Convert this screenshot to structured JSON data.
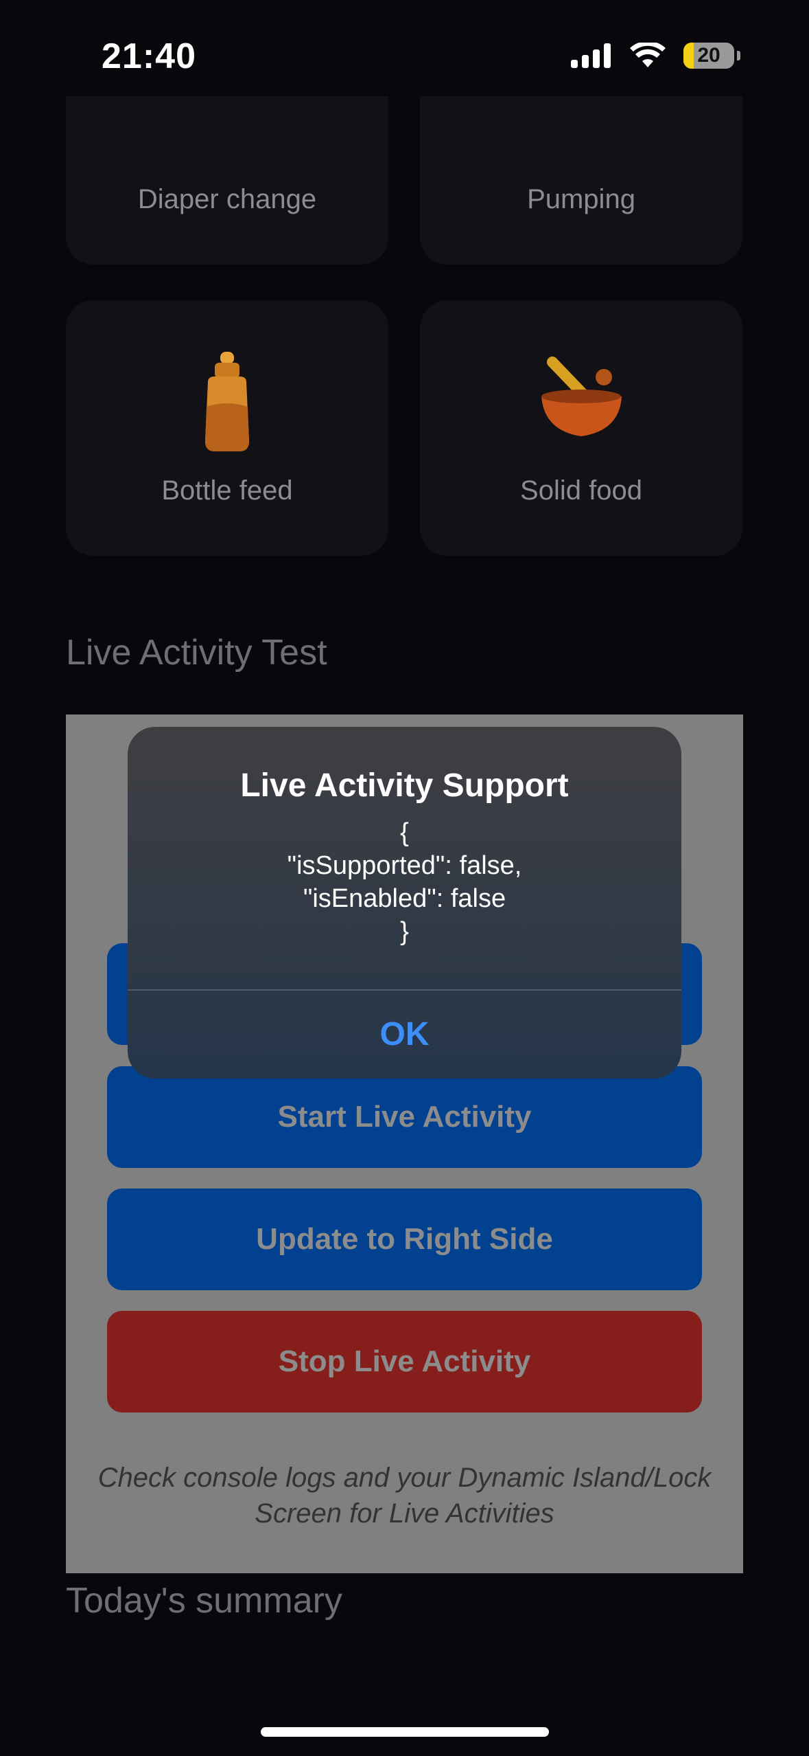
{
  "status_bar": {
    "time": "21:40",
    "battery_level": "20",
    "battery_color": "#f5d116",
    "icons": [
      "cellular-signal-icon",
      "wifi-icon",
      "battery-icon"
    ]
  },
  "tracking_cards": [
    {
      "label": "Diaper change",
      "icon": "diaper-icon"
    },
    {
      "label": "Pumping",
      "icon": "pump-icon"
    },
    {
      "label": "Bottle feed",
      "icon": "baby-bottle-icon"
    },
    {
      "label": "Solid food",
      "icon": "bowl-icon"
    }
  ],
  "live_activity_section": {
    "title": "Live Activity Test",
    "buttons": {
      "start": "Start Live Activity",
      "update": "Update to Right Side",
      "stop": "Stop Live Activity"
    },
    "hint": "Check console logs and your Dynamic Island/Lock Screen for Live Activities"
  },
  "summary_section": {
    "title": "Today's summary"
  },
  "alert": {
    "title": "Live Activity Support",
    "message": "{\n\"isSupported\": false,\n\"isEnabled\": false\n}",
    "ok_label": "OK",
    "ok_color": "#3c8ef8"
  }
}
